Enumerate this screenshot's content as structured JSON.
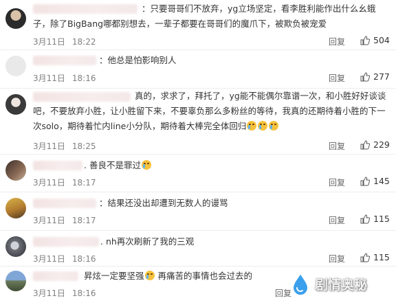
{
  "comments": [
    {
      "text": "：只要哥哥们不放弃，yg立场坚定，看李胜利能作出什么幺蛾子，除了BigBang哪都别想去，一辈子都要在哥哥们的魔爪下，被欺负被宠爱",
      "date": "3月11日",
      "time": "18:22",
      "reply": "回复",
      "likes": "504"
    },
    {
      "text": "：他总是怕影响别人",
      "date": "3月11日",
      "time": "18:16",
      "reply": "回复",
      "likes": "277"
    },
    {
      "text": "真的，求求了，拜托了，yg能不能偶尔靠谱一次，和小胜好好谈谈吧，不要放弃小胜，让小胜留下来，不要辜负那么多粉丝的等待，我真的还期待着小胜的下一次solo，期待着忙内line小分队，期待着大棒完全体回归",
      "date": "3月11日",
      "time": "18:25",
      "reply": "回复",
      "likes": "229"
    },
    {
      "text": ". 善良不是罪过",
      "date": "3月11日",
      "time": "18:17",
      "reply": "回复",
      "likes": "145"
    },
    {
      "text": "：结果还没出却遭到无数人的谩骂",
      "date": "3月11日",
      "time": "18:17",
      "reply": "回复",
      "likes": "115"
    },
    {
      "text": ". nh再次刷新了我的三观",
      "date": "3月11日",
      "time": "18:16",
      "reply": "回复",
      "likes": "115"
    },
    {
      "text": "昇炫一定要坚强",
      "text2": "再痛苦的事情也会过去的",
      "date": "3月11日",
      "time": "18:16",
      "reply": "回复",
      "likes": ""
    }
  ],
  "watermark": "剧情奥秘",
  "colors": {
    "accent": "#f6c23e",
    "muted": "#808080"
  }
}
